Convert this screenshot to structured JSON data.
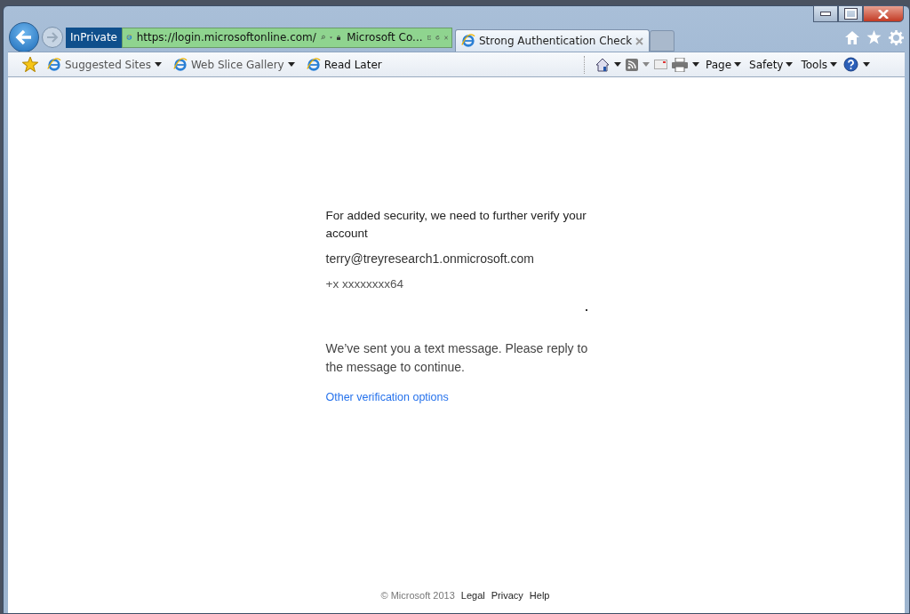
{
  "browser": {
    "mode_badge": "InPrivate",
    "address": "https://login.microsoftonline.com/",
    "site_identity": "Microsoft Co...",
    "tabs": [
      {
        "title": "Strong Authentication Check",
        "selected": true
      }
    ]
  },
  "favorites_bar": [
    {
      "label": "Suggested Sites",
      "dropdown": true
    },
    {
      "label": "Web Slice Gallery",
      "dropdown": true
    },
    {
      "label": "Read Later",
      "dropdown": false
    }
  ],
  "command_bar": {
    "menus": [
      "Page",
      "Safety",
      "Tools"
    ]
  },
  "page": {
    "heading": "For added security, we need to further verify your account",
    "email": "terry@treyresearch1.onmicrosoft.com",
    "phone": "+x xxxxxxxx64",
    "message": "We’ve sent you a text message. Please reply to the message to continue.",
    "link": "Other verification options"
  },
  "footer": {
    "copyright": "© Microsoft 2013",
    "links": [
      "Legal",
      "Privacy",
      "Help"
    ]
  }
}
